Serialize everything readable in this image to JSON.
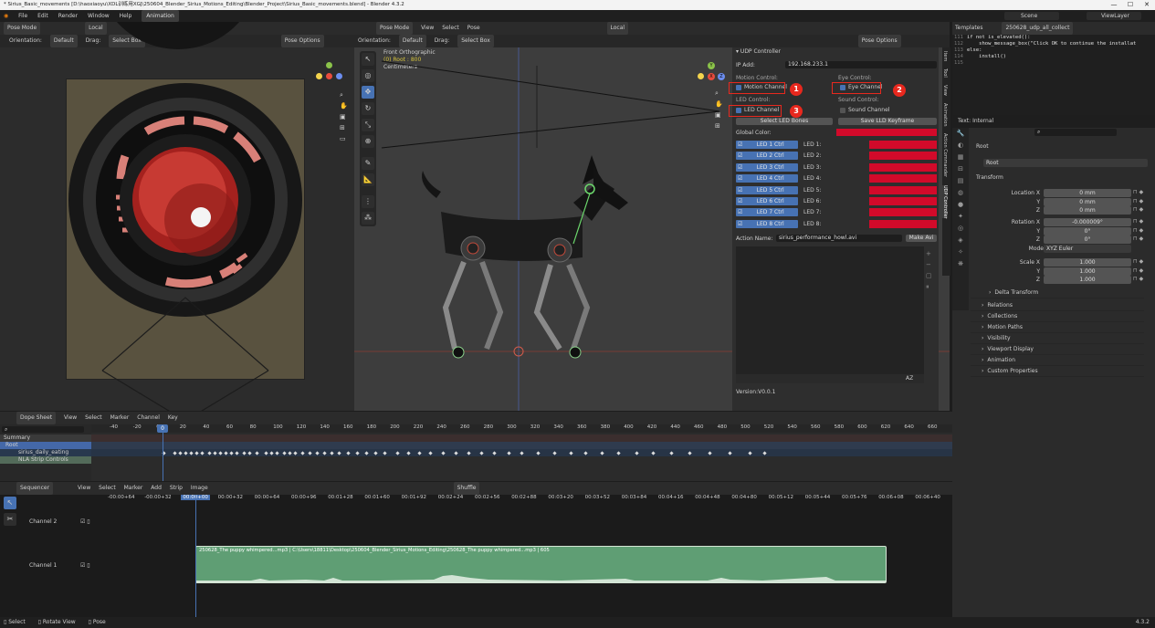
{
  "window": {
    "title": "* Sirius_Basic_movements [D:\\haoxiaoyu\\XDL训练用XGJ\\250604_Blender_Sirius_Motions_Editing\\Blender_Project\\Sirius_Basic_movements.blend] - Blender 4.3.2",
    "minimize": "—",
    "maximize": "☐",
    "close": "✕"
  },
  "menu": {
    "items": [
      "File",
      "Edit",
      "Render",
      "Window",
      "Help"
    ],
    "active_tab": "Animation",
    "scene": "Scene",
    "view_layer": "ViewLayer"
  },
  "left_viewport": {
    "mode": "Pose Mode",
    "transform": "Local",
    "orientation_label": "Orientation:",
    "orientation": "Default",
    "drag_label": "Drag:",
    "drag": "Select Box",
    "pose_options": "Pose Options"
  },
  "main_viewport": {
    "mode": "Pose Mode",
    "menus": [
      "View",
      "Select",
      "Pose"
    ],
    "transform": "Local",
    "orientation_label": "Orientation:",
    "orientation": "Default",
    "drag_label": "Drag:",
    "drag": "Select Box",
    "pose_options": "Pose Options",
    "view_name": "Front Orthographic",
    "view_sub": "(0) Root : 800",
    "units": "Centimeters",
    "gizmo_labels": {
      "y": "Y",
      "x": "X",
      "z": "Z"
    }
  },
  "side_tabs": [
    "Item",
    "Tool",
    "View",
    "Animation",
    "Action Commander",
    "UDP Controller"
  ],
  "udp": {
    "header": "UDP Controller",
    "ip_label": "IP Add:",
    "ip_value": "192.168.233.1",
    "motion_control": "Motion Control:",
    "motion_channel": "Motion Channel",
    "eye_control": "Eye Control:",
    "eye_channel": "Eye Channel",
    "led_control": "LED Control:",
    "led_channel": "LED Channel",
    "sound_control": "Sound Control:",
    "sound_channel": "Sound Channel",
    "select_led_bones": "Select LED Bones",
    "save_led_keyframe": "Save LLD Keyframe",
    "global_color": "Global Color:",
    "led_rows": [
      {
        "btn": "LED 1 Ctrl",
        "label": "LED 1:"
      },
      {
        "btn": "LED 2 Ctrl",
        "label": "LED 2:"
      },
      {
        "btn": "LED 3 Ctrl",
        "label": "LED 3:"
      },
      {
        "btn": "LED 4 Ctrl",
        "label": "LED 4:"
      },
      {
        "btn": "LED 5 Ctrl",
        "label": "LED 5:"
      },
      {
        "btn": "LED 6 Ctrl",
        "label": "LED 6:"
      },
      {
        "btn": "LED 7 Ctrl",
        "label": "LED 7:"
      },
      {
        "btn": "LED 8 Ctrl",
        "label": "LED 8:"
      }
    ],
    "action_name_label": "Action Name:",
    "action_name": "sirius_performance_howl.avi",
    "make_avi": "Make Avi",
    "version": "Version:V0.0.1",
    "annotations": [
      "1",
      "2",
      "3"
    ],
    "list_sort": "AZ"
  },
  "text_editor": {
    "tab": "Templates",
    "file": "250628_udp_all_collect",
    "lines": [
      {
        "num": "111",
        "code": "if not is_elevated():"
      },
      {
        "num": "112",
        "code": "    show_message_box(\"Click OK to continue the installat"
      },
      {
        "num": "113",
        "code": "else:"
      },
      {
        "num": "114",
        "code": "    install()"
      },
      {
        "num": "115",
        "code": ""
      }
    ]
  },
  "properties": {
    "header": "Text: Internal",
    "bone": "Root",
    "bone_field": "Root",
    "transform": "Transform",
    "location": [
      {
        "label": "Location X",
        "value": "0 mm"
      },
      {
        "label": "Y",
        "value": "0 mm"
      },
      {
        "label": "Z",
        "value": "0 mm"
      }
    ],
    "rotation": [
      {
        "label": "Rotation X",
        "value": "-0.000009°"
      },
      {
        "label": "Y",
        "value": "0°"
      },
      {
        "label": "Z",
        "value": "0°"
      }
    ],
    "mode_label": "Mode",
    "mode": "XYZ Euler",
    "scale": [
      {
        "label": "Scale X",
        "value": "1.000"
      },
      {
        "label": "Y",
        "value": "1.000"
      },
      {
        "label": "Z",
        "value": "1.000"
      }
    ],
    "sections": [
      "Delta Transform",
      "Relations",
      "Collections",
      "Motion Paths",
      "Visibility",
      "Viewport Display",
      "Animation",
      "Custom Properties"
    ]
  },
  "dopesheet": {
    "editor": "Dope Sheet",
    "menus": [
      "View",
      "Select",
      "Marker",
      "Channel",
      "Key"
    ],
    "ruler": [
      "-40",
      "-20",
      "0",
      "20",
      "40",
      "60",
      "80",
      "100",
      "120",
      "140",
      "160",
      "180",
      "200",
      "220",
      "240",
      "260",
      "280",
      "300",
      "320",
      "340",
      "360",
      "380",
      "400",
      "420",
      "440",
      "460",
      "480",
      "500",
      "520",
      "540",
      "560",
      "580",
      "600",
      "620",
      "640",
      "660"
    ],
    "current_frame": "0",
    "channels": [
      "Summary",
      "Root",
      "sirius_daily_eating",
      "NLA Strip Controls"
    ]
  },
  "sequencer": {
    "editor": "Sequencer",
    "menus": [
      "View",
      "Select",
      "Marker",
      "Add",
      "Strip",
      "Image"
    ],
    "shuffle": "Shuffle",
    "ruler": [
      "-00:00+64",
      "-00:00+32",
      "00:00+00",
      "00:00+32",
      "00:00+64",
      "00:00+96",
      "00:01+28",
      "00:01+60",
      "00:01+92",
      "00:02+24",
      "00:02+56",
      "00:02+88",
      "00:03+20",
      "00:03+52",
      "00:03+84",
      "00:04+16",
      "00:04+48",
      "00:04+80",
      "00:05+12",
      "00:05+44",
      "00:05+76",
      "00:06+08",
      "00:06+40"
    ],
    "channels": [
      "Channel 2",
      "Channel 1"
    ],
    "strip_label": "250628_The puppy whimpered...mp3 | C:\\Users\\18811\\Desktop\\250604_Blender_Sirius_Motions_Editing\\250628_The puppy whimpered...mp3 | 605"
  },
  "status": {
    "items": [
      "Select",
      "Rotate View",
      "Pose"
    ],
    "version": "4.3.2"
  },
  "colors": {
    "accent": "#4772b3",
    "led_red": "#d20a2a",
    "annotation_red": "#e8281e",
    "strip_green": "#5f9e74"
  }
}
